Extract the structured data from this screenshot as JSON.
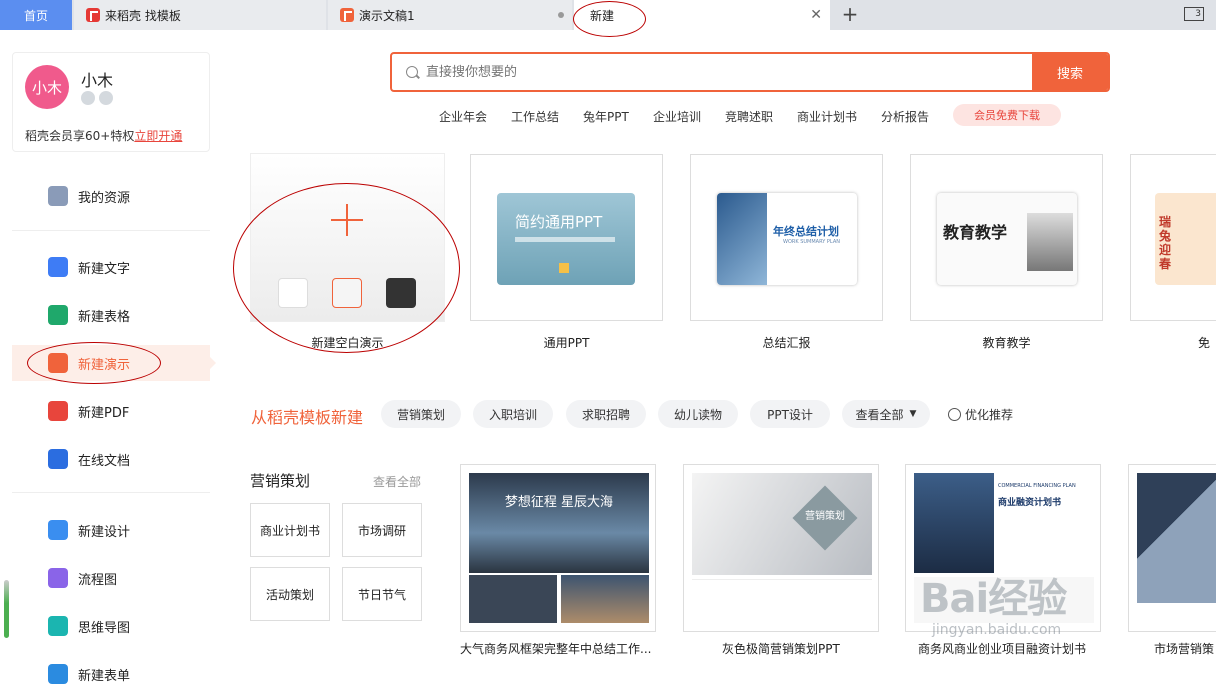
{
  "tabs": {
    "home": "首页",
    "docer": "来稻壳 找模板",
    "ppt": "演示文稿1",
    "new": "新建",
    "page_count": "3"
  },
  "user": {
    "avatar_text": "小木",
    "name": "小木",
    "promo_text": "稻壳会员享60+特权",
    "promo_link": "立即开通"
  },
  "sidebar": {
    "resources": "我的资源",
    "new_text": "新建文字",
    "new_sheet": "新建表格",
    "new_ppt": "新建演示",
    "new_pdf": "新建PDF",
    "online_doc": "在线文档",
    "new_design": "新建设计",
    "flowchart": "流程图",
    "mindmap": "思维导图",
    "new_form": "新建表单"
  },
  "search": {
    "placeholder": "直接搜你想要的",
    "button": "搜索"
  },
  "hot_keywords": [
    "企业年会",
    "工作总结",
    "兔年PPT",
    "企业培训",
    "竞聘述职",
    "商业计划书",
    "分析报告"
  ],
  "vip_pill": "会员免费下载",
  "templates": {
    "blank": "新建空白演示",
    "general": "通用PPT",
    "summary": "总结汇报",
    "education": "教育教学",
    "partial": "免"
  },
  "thumbs": {
    "general_title": "简约通用PPT",
    "summary_title": "年终总结计划",
    "summary_sub": "WORK SUMMARY PLAN",
    "education_title": "教育教学",
    "spring_title": "瑞兔迎春"
  },
  "docer_section": {
    "title": "从稻壳模板新建",
    "chips": [
      "营销策划",
      "入职培训",
      "求职招聘",
      "幼儿读物",
      "PPT设计"
    ],
    "view_all": "查看全部",
    "optimize": "优化推荐"
  },
  "category": {
    "title": "营销策划",
    "view_all": "查看全部",
    "subs": [
      "商业计划书",
      "市场调研",
      "活动策划",
      "节日节气"
    ]
  },
  "cards": {
    "c1": {
      "caption": "大气商务风框架完整年中总结工作...",
      "thumb_title": "梦想征程 星辰大海"
    },
    "c2": {
      "caption": "灰色极简营销策划PPT",
      "thumb_title": "营销策划"
    },
    "c3": {
      "caption": "商务风商业创业项目融资计划书",
      "thumb_title": "商业融资计划书",
      "thumb_sub": "COMMERCIAL FINANCING PLAN"
    },
    "c4": {
      "caption": "市场营销策"
    }
  },
  "watermark": {
    "main": "Bai经验",
    "url": "jingyan.baidu.com"
  },
  "colors": {
    "accent": "#f0633b",
    "home_tab": "#5b8ef0",
    "annotation": "#b00000"
  }
}
